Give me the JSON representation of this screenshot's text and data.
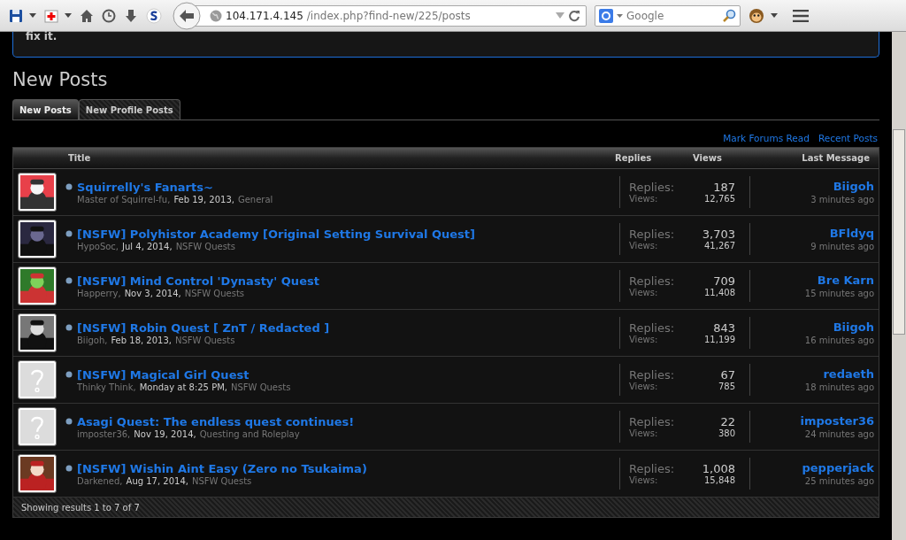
{
  "browser": {
    "url_host": "104.171.4.145",
    "url_path": "/index.php?find-new/225/posts",
    "search_engine": "Google"
  },
  "notice": {
    "text": "fix it."
  },
  "heading": "New Posts",
  "tabs": [
    {
      "label": "New Posts",
      "selected": true
    },
    {
      "label": "New Profile Posts",
      "selected": false
    }
  ],
  "links": [
    "Mark Forums Read",
    "Recent Posts"
  ],
  "table": {
    "columns": [
      "Title",
      "Replies",
      "Views",
      "Last Message"
    ],
    "rows": [
      {
        "title": "Squirrelly's Fanarts~",
        "author": "Master of Squirrel-fu,",
        "date": "Feb 19, 2013,",
        "forum": "General",
        "replies_label": "Replies:",
        "replies": "187",
        "views_label": "Views:",
        "views": "12,765",
        "last_user": "Biigoh",
        "last_time": "3 minutes ago"
      },
      {
        "title": "[NSFW] Polyhistor Academy [Original Setting Survival Quest]",
        "author": "HypoSoc,",
        "date": "Jul 4, 2014,",
        "forum": "NSFW Quests",
        "replies_label": "Replies:",
        "replies": "3,703",
        "views_label": "Views:",
        "views": "41,267",
        "last_user": "BFldyq",
        "last_time": "9 minutes ago"
      },
      {
        "title": "[NSFW] Mind Control 'Dynasty' Quest",
        "author": "Happerry,",
        "date": "Nov 3, 2014,",
        "forum": "NSFW Quests",
        "replies_label": "Replies:",
        "replies": "709",
        "views_label": "Views:",
        "views": "11,408",
        "last_user": "Bre Karn",
        "last_time": "15 minutes ago"
      },
      {
        "title": "[NSFW] Robin Quest [ ZnT / Redacted ]",
        "author": "Biigoh,",
        "date": "Feb 18, 2013,",
        "forum": "NSFW Quests",
        "replies_label": "Replies:",
        "replies": "843",
        "views_label": "Views:",
        "views": "11,199",
        "last_user": "Biigoh",
        "last_time": "16 minutes ago"
      },
      {
        "title": "[NSFW] Magical Girl Quest",
        "author": "Thinky Think,",
        "date": "Monday at 8:25 PM,",
        "forum": "NSFW Quests",
        "replies_label": "Replies:",
        "replies": "67",
        "views_label": "Views:",
        "views": "785",
        "last_user": "redaeth",
        "last_time": "18 minutes ago"
      },
      {
        "title": "Asagi Quest: The endless quest continues!",
        "author": "imposter36,",
        "date": "Nov 19, 2014,",
        "forum": "Questing and Roleplay",
        "replies_label": "Replies:",
        "replies": "22",
        "views_label": "Views:",
        "views": "380",
        "last_user": "imposter36",
        "last_time": "24 minutes ago"
      },
      {
        "title": "[NSFW] Wishin Aint Easy (Zero no Tsukaima)",
        "author": "Darkened,",
        "date": "Aug 17, 2014,",
        "forum": "NSFW Quests",
        "replies_label": "Replies:",
        "replies": "1,008",
        "views_label": "Views:",
        "views": "15,848",
        "last_user": "pepperjack",
        "last_time": "25 minutes ago"
      }
    ],
    "footer": "Showing results 1 to 7 of 7"
  }
}
